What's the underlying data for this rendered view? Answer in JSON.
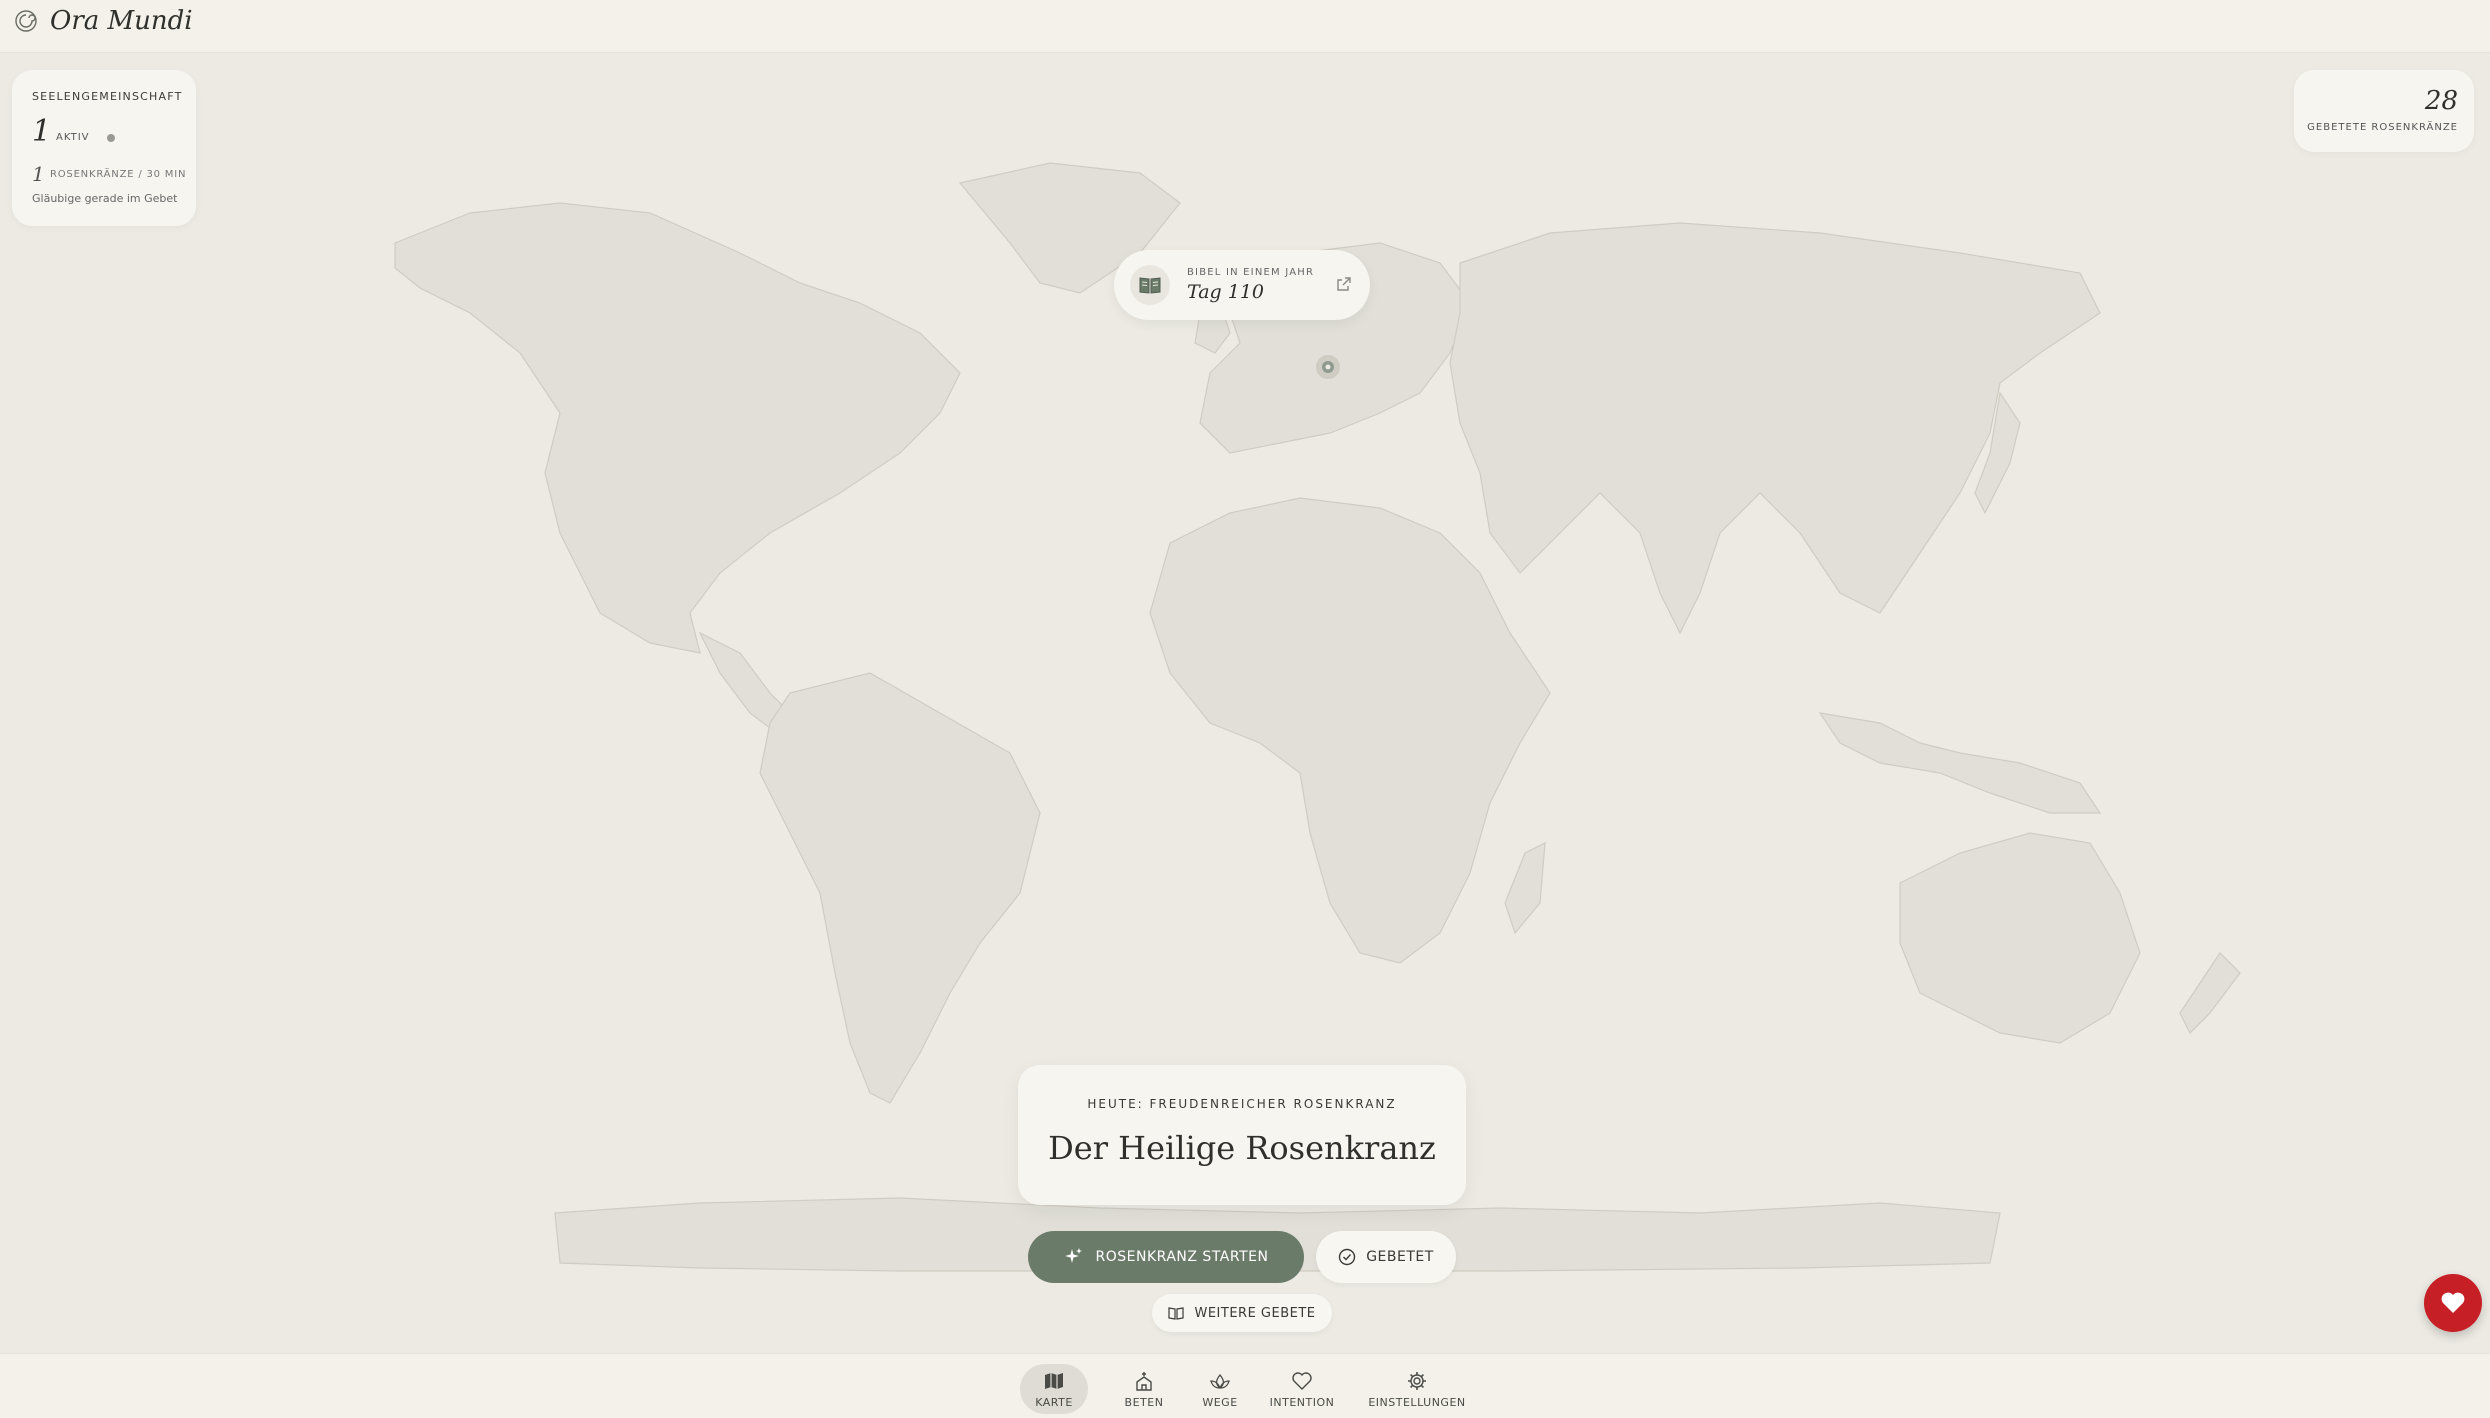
{
  "app": {
    "title": "Ora Mundi"
  },
  "community": {
    "title": "SEELENGEMEINSCHAFT",
    "active_count": "1",
    "active_label": "AKTIV",
    "rosaries_count": "1",
    "rosaries_label": "ROSENKRÄNZE / 30 MIN",
    "subtitle": "Gläubige gerade im Gebet"
  },
  "counter": {
    "value": "28",
    "label": "GEBETETE ROSENKRÄNZE"
  },
  "bible": {
    "label": "BIBEL IN EINEM JAHR",
    "value": "Tag 110"
  },
  "rosary": {
    "today": "HEUTE: FREUDENREICHER ROSENKRANZ",
    "title": "Der Heilige Rosenkranz",
    "start_label": "ROSENKRANZ STARTEN",
    "done_label": "GEBETET",
    "more_label": "WEITERE GEBETE"
  },
  "nav": [
    {
      "label": "KARTE",
      "icon": "map-icon",
      "active": true
    },
    {
      "label": "BETEN",
      "icon": "church-icon"
    },
    {
      "label": "WEGE",
      "icon": "lotus-icon"
    },
    {
      "label": "INTENTION",
      "icon": "heart-icon"
    },
    {
      "label": "EINSTELLUNGEN",
      "icon": "gear-icon"
    }
  ],
  "colors": {
    "background": "#eceae3",
    "land": "#e1dfd8",
    "accent_green": "#6b7b6a",
    "heart_red": "#c62026"
  }
}
